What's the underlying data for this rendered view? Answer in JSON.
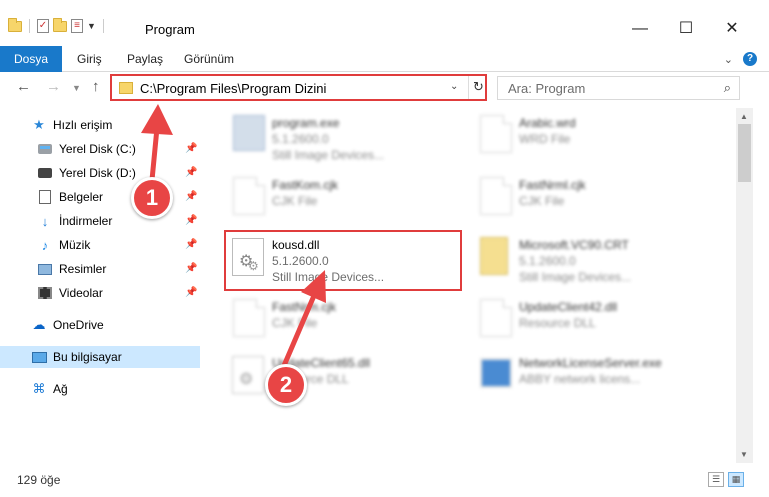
{
  "window": {
    "title": "Program",
    "minimize": "—",
    "maximize": "☐",
    "close": "✕"
  },
  "ribbon": {
    "tabs": [
      "Dosya",
      "Giriş",
      "Paylaş",
      "Görünüm"
    ],
    "help": "?"
  },
  "address": {
    "path": "C:\\Program Files\\Program Dizini",
    "search_placeholder": "Ara: Program"
  },
  "sidebar": {
    "items": [
      {
        "label": "Hızlı erişim",
        "icon": "star-icon"
      },
      {
        "label": "Yerel Disk (C:)",
        "icon": "drive-icon",
        "pinned": true
      },
      {
        "label": "Yerel Disk (D:)",
        "icon": "drive-icon",
        "pinned": true
      },
      {
        "label": "Belgeler",
        "icon": "documents-icon",
        "pinned": true
      },
      {
        "label": "İndirmeler",
        "icon": "download-icon",
        "pinned": true
      },
      {
        "label": "Müzik",
        "icon": "music-icon",
        "pinned": true
      },
      {
        "label": "Resimler",
        "icon": "pictures-icon",
        "pinned": true
      },
      {
        "label": "Videolar",
        "icon": "video-icon",
        "pinned": true
      },
      {
        "label": "OneDrive",
        "icon": "cloud-icon"
      },
      {
        "label": "Bu bilgisayar",
        "icon": "computer-icon",
        "selected": true
      },
      {
        "label": "Ağ",
        "icon": "network-icon"
      }
    ]
  },
  "files": {
    "col1": [
      {
        "name": "program.exe",
        "line2": "5.1.2600.0",
        "line3": "Still Image Devices..."
      },
      {
        "name": "FastKom.cjk",
        "line2": "CJK File",
        "line3": ""
      },
      {
        "name": "kousd.dll",
        "line2": "5.1.2600.0",
        "line3": "Still Image Devices..."
      },
      {
        "name": "FastNrm.cjk",
        "line2": "CJK File",
        "line3": ""
      },
      {
        "name": "UpdateClient65.dll",
        "line2": "Resource DLL",
        "line3": ""
      }
    ],
    "col2": [
      {
        "name": "Arabic.wrd",
        "line2": "WRD File",
        "line3": ""
      },
      {
        "name": "FastNrml.cjk",
        "line2": "CJK File",
        "line3": ""
      },
      {
        "name": "Microsoft.VC90.CRT",
        "line2": "5.1.2600.0",
        "line3": "Still Image Devices..."
      },
      {
        "name": "UpdateClient42.dll",
        "line2": "Resource DLL",
        "line3": ""
      },
      {
        "name": "NetworkLicenseServer.exe",
        "line2": "ABBY network licens...",
        "line3": ""
      }
    ]
  },
  "status": {
    "item_count": "129 öğe"
  },
  "annotations": {
    "step1": "1",
    "step2": "2",
    "color": "#e84545"
  }
}
